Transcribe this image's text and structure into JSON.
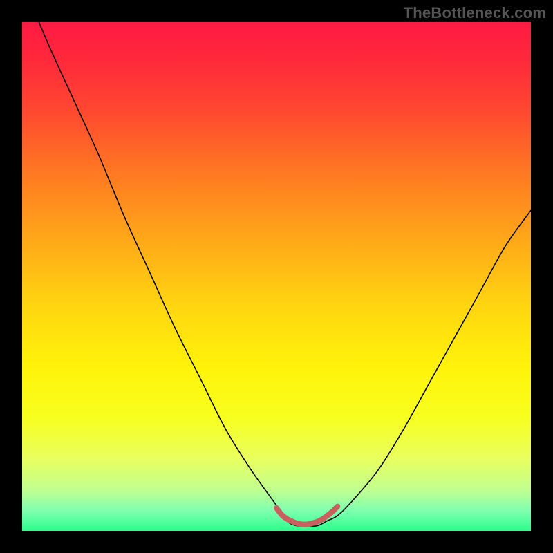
{
  "watermark": "TheBottleneck.com",
  "chart_data": {
    "type": "line",
    "title": "",
    "xlabel": "",
    "ylabel": "",
    "xlim": [
      0,
      100
    ],
    "ylim": [
      0,
      100
    ],
    "series": [
      {
        "name": "bottleneck-percentage",
        "x": [
          0,
          5,
          10,
          15,
          20,
          25,
          30,
          35,
          40,
          45,
          50,
          52,
          54,
          56,
          58,
          60,
          62,
          65,
          70,
          75,
          80,
          85,
          90,
          95,
          100
        ],
        "y": [
          108,
          96,
          85,
          74,
          62,
          51,
          40,
          30,
          20,
          12,
          5,
          2,
          1,
          1,
          1,
          2,
          3,
          6,
          12,
          20,
          29,
          38,
          47,
          56,
          63
        ]
      },
      {
        "name": "optimal-zone-marker",
        "x": [
          50,
          51,
          52,
          53,
          54,
          55,
          56,
          57,
          58,
          59,
          60,
          61,
          62
        ],
        "y": [
          4.5,
          3.2,
          2.4,
          1.9,
          1.5,
          1.3,
          1.3,
          1.5,
          1.8,
          2.3,
          3.0,
          3.8,
          4.8
        ]
      }
    ],
    "gradient_stops": [
      {
        "offset": 0.0,
        "color": "#ff1a44"
      },
      {
        "offset": 0.08,
        "color": "#ff2a3a"
      },
      {
        "offset": 0.18,
        "color": "#ff4a2f"
      },
      {
        "offset": 0.3,
        "color": "#ff7a22"
      },
      {
        "offset": 0.42,
        "color": "#ffa519"
      },
      {
        "offset": 0.55,
        "color": "#ffd310"
      },
      {
        "offset": 0.68,
        "color": "#fff30a"
      },
      {
        "offset": 0.78,
        "color": "#f7ff20"
      },
      {
        "offset": 0.86,
        "color": "#e8ff60"
      },
      {
        "offset": 0.92,
        "color": "#c0ff90"
      },
      {
        "offset": 0.96,
        "color": "#7fffb0"
      },
      {
        "offset": 1.0,
        "color": "#2aff8a"
      }
    ],
    "marker_color": "#c86060",
    "marker_width": 8,
    "curve_color": "#000000",
    "curve_width": 1.6
  }
}
